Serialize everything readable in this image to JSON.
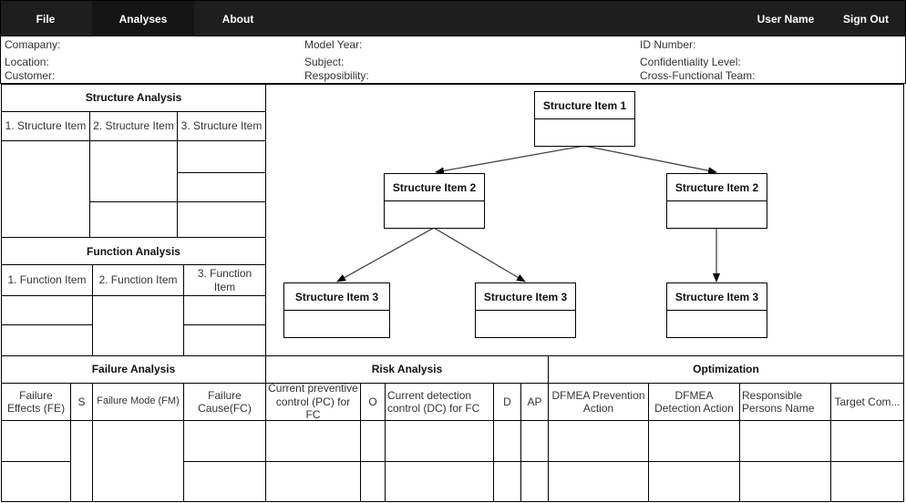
{
  "nav": {
    "file": "File",
    "analyses": "Analyses",
    "about": "About",
    "user_name": "User Name",
    "sign_out": "Sign Out"
  },
  "info": {
    "company": "Comapany:",
    "location": "Location:",
    "customer": "Customer:",
    "model_year": "Model Year:",
    "subject": "Subject:",
    "responsibility": "Resposibility:",
    "id_number": "ID Number:",
    "confidentiality": "Confidentiality Level:",
    "team": "Cross-Functional Team:"
  },
  "structure_analysis": {
    "title": "Structure Analysis",
    "col1": "1. Structure Item",
    "col2": "2. Structure Item",
    "col3": "3. Structure Item"
  },
  "function_analysis": {
    "title": "Function Analysis",
    "col1": "1. Function  Item",
    "col2": "2. Function  Item",
    "col3": "3. Function Item"
  },
  "tree": {
    "root": "Structure Item 1",
    "level2_left": "Structure Item 2",
    "level2_right": "Structure Item 2",
    "level3_a": "Structure Item 3",
    "level3_b": "Structure Item 3",
    "level3_c": "Structure Item 3"
  },
  "failure_analysis": {
    "title": "Failure Analysis",
    "fe": "Failure Effects (FE)",
    "s": "S",
    "fm": "Failure Mode (FM)",
    "fc": "Failure Cause(FC)"
  },
  "risk_analysis": {
    "title": "Risk Analysis",
    "pc": "Current preventive control (PC) for FC",
    "o": "O",
    "dc": "Current detection control (DC) for FC",
    "d": "D",
    "ap": "AP"
  },
  "optimization": {
    "title": "Optimization",
    "prevention": "DFMEA Prevention Action",
    "detection": "DFMEA Detection Action",
    "responsible": "Responsible Persons Name",
    "target": "Target Com..."
  }
}
